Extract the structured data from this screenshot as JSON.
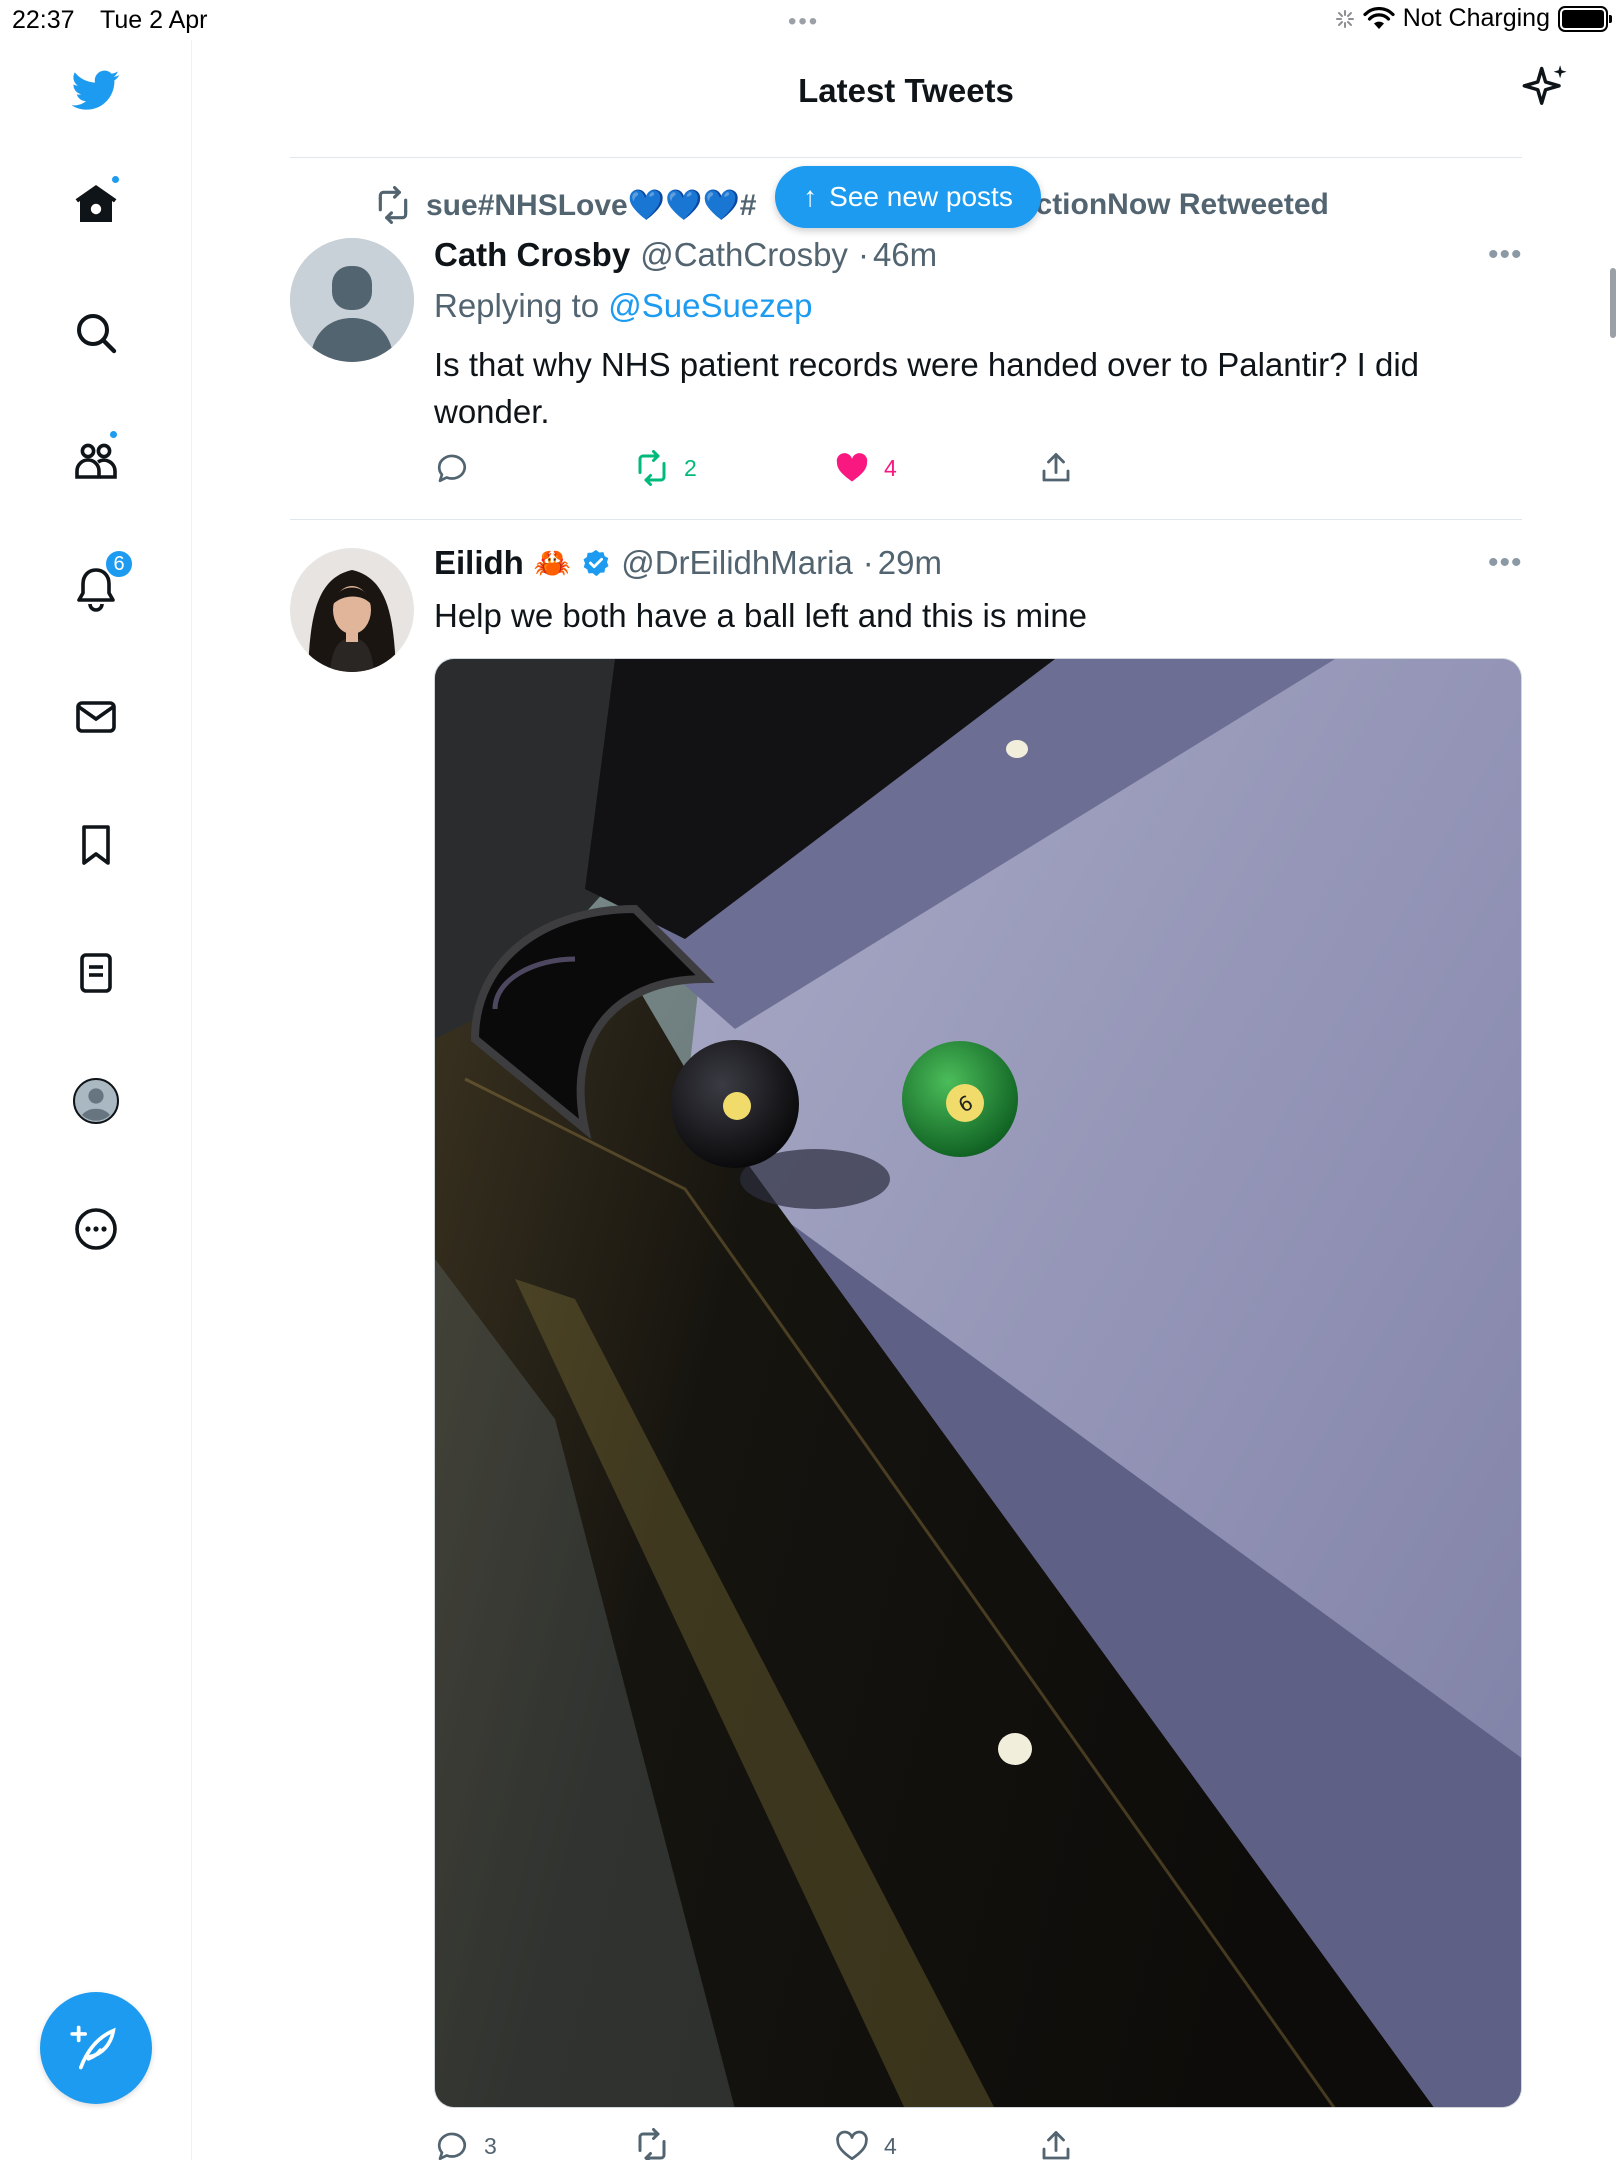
{
  "status_bar": {
    "time": "22:37",
    "date": "Tue 2 Apr",
    "charging": "Not Charging"
  },
  "header": {
    "title": "Latest Tweets"
  },
  "new_posts": {
    "label": "See new posts"
  },
  "sidebar": {
    "items": [
      {
        "name": "home-icon"
      },
      {
        "name": "search-icon"
      },
      {
        "name": "communities-icon"
      },
      {
        "name": "notifications-icon",
        "badge": "6"
      },
      {
        "name": "messages-icon"
      },
      {
        "name": "bookmarks-icon"
      },
      {
        "name": "lists-icon"
      },
      {
        "name": "profile-icon"
      },
      {
        "name": "more-icon"
      }
    ],
    "compose": {
      "name": "compose-icon"
    }
  },
  "tweets": [
    {
      "retweeted_by": "sue#NHSLove💙💙💙#",
      "retweeted_suffix": "lectionNow Retweeted",
      "name": "Cath Crosby",
      "handle": "@CathCrosby",
      "time": "46m",
      "replying_prefix": "Replying to",
      "replying_to": "@SueSuezep",
      "text": "Is that why NHS patient records were handed over to Palantir? I did wonder.",
      "retweets": "2",
      "likes": "4"
    },
    {
      "name": "Eilidh",
      "emoji": "🦀",
      "handle": "@DrEilidhMaria",
      "time": "29m",
      "text": "Help we both have a ball left and this is mine",
      "replies": "3",
      "likes": "4"
    }
  ],
  "colors": {
    "accent": "#1d9bf0",
    "retweet_green": "#00ba7c",
    "like_pink": "#f91880",
    "muted": "#536471"
  }
}
